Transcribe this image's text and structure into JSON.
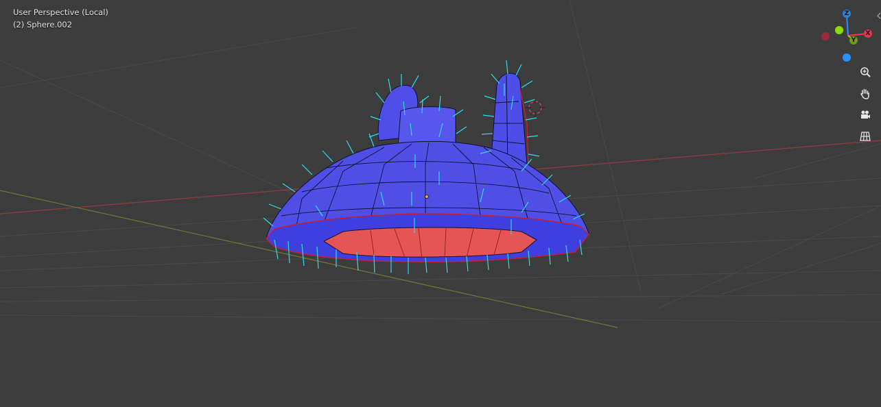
{
  "viewport": {
    "view_name": "User Perspective (Local)",
    "object_name": "(2) Sphere.002",
    "background_color": "#3d3d3d"
  },
  "gizmo": {
    "axis_z_label": "Z",
    "axis_y_label": "Y",
    "axis_x_label": "X",
    "x_color": "#ff3352",
    "y_color": "#8bdc00",
    "z_color": "#2890ff"
  },
  "nav_buttons": {
    "zoom_icon": "zoom-icon",
    "pan_icon": "hand-pan-icon",
    "camera_icon": "camera-icon",
    "ortho_icon": "grid-ortho-icon"
  },
  "mesh": {
    "face_color": "#4b4bea",
    "inner_face_color": "#e85050",
    "normal_color": "#27e0f0"
  }
}
